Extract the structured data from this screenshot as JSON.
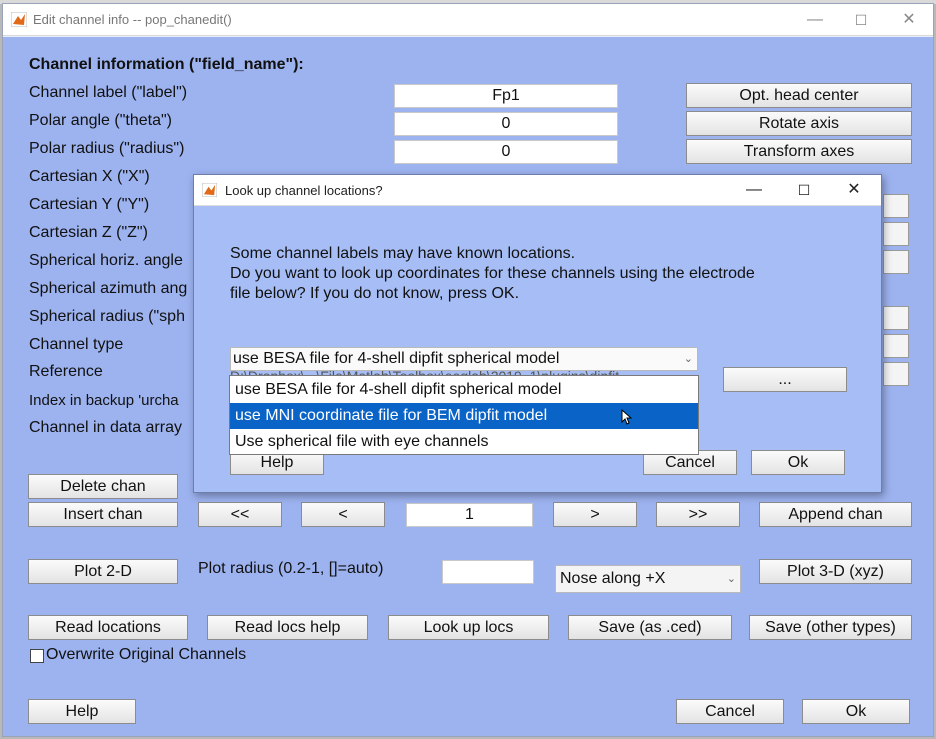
{
  "main_window": {
    "title": "Edit channel info -- pop_chanedit()",
    "controls": {
      "minimize": "—",
      "maximize": "☐",
      "close": "✕"
    },
    "header": "Channel information (\"field_name\"):",
    "labels": [
      "Channel label (\"label\")",
      "Polar angle (\"theta\")",
      "Polar radius (\"radius\")",
      "Cartesian X (\"X\")",
      "Cartesian Y (\"Y\")",
      "Cartesian Z (\"Z\")",
      "Spherical horiz. angle",
      "Spherical azimuth ang",
      "Spherical radius (\"sph",
      "Channel type",
      "Reference",
      "Index in backup 'urcha",
      "Channel in data array"
    ],
    "fields": {
      "label": "Fp1",
      "theta": "0",
      "radius": "0"
    },
    "right_buttons": [
      "Opt. head center",
      "Rotate axis",
      "Transform axes"
    ],
    "delete_chan": "Delete chan",
    "insert_chan": "Insert chan",
    "nav": {
      "first": "<<",
      "prev": "<",
      "index": "1",
      "next": ">",
      "last": ">>"
    },
    "append_chan": "Append chan",
    "plot_2d": "Plot 2-D",
    "plot_radius_label": "Plot radius (0.2-1, []=auto)",
    "plot_radius_value": "",
    "nose_select": "Nose along +X",
    "plot_3d": "Plot 3-D (xyz)",
    "bottom_buttons": [
      "Read locations",
      "Read locs help",
      "Look up locs",
      "Save (as .ced)",
      "Save (other types)"
    ],
    "overwrite_label": "Overwrite Original Channels",
    "overwrite_checked": false,
    "help": "Help",
    "cancel": "Cancel",
    "ok": "Ok"
  },
  "dialog": {
    "title": "Look up channel locations?",
    "controls": {
      "minimize": "—",
      "maximize": "☐",
      "close": "✕"
    },
    "message": [
      "Some channel labels may have known locations.",
      "Do you want to look up coordinates for these channels using the electrode",
      "file below? If you do not know, press OK."
    ],
    "selected": "use BESA file for 4-shell dipfit spherical model",
    "partial_path": "D:\\Dropbox\\...\\File\\Matlab\\Toolbox\\eeglab\\2019_1\\plugins\\dipfit",
    "options": [
      "use BESA file for 4-shell dipfit spherical model",
      "use MNI coordinate file for BEM dipfit model",
      "Use spherical file with eye channels"
    ],
    "highlighted_index": 1,
    "browse": "...",
    "help": "Help",
    "cancel": "Cancel",
    "ok": "Ok"
  },
  "colors": {
    "panel_bg": "#9db3f0",
    "dialog_bg": "#a6bdf5",
    "highlight": "#0a64c8"
  }
}
